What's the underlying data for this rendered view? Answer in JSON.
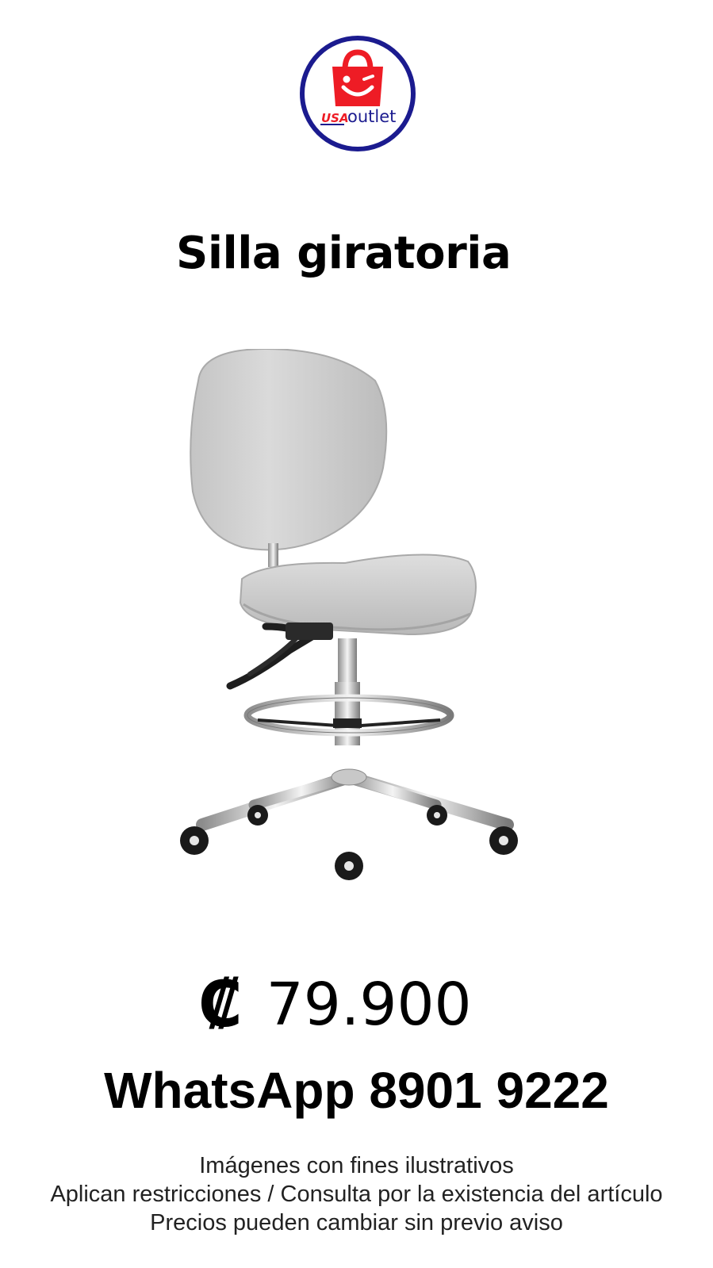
{
  "logo": {
    "brand_word": "USA",
    "text": "outlet",
    "colors": {
      "ring": "#1b1b8f",
      "bag": "#ee1c25",
      "inner": "#ffffff"
    },
    "icon": "shopping-bag-smile-icon"
  },
  "product": {
    "title": "Silla giratoria",
    "image_icon": "swivel-chair-image",
    "chair_color": "#cfcfcf"
  },
  "price": {
    "currency": "₡",
    "amount": "79.900"
  },
  "contact": {
    "text": "WhatsApp 8901 9222"
  },
  "disclaimers": [
    "Imágenes con fines ilustrativos",
    "Aplican restricciones / Consulta por la existencia del artículo",
    "Precios pueden cambiar sin previo aviso"
  ]
}
